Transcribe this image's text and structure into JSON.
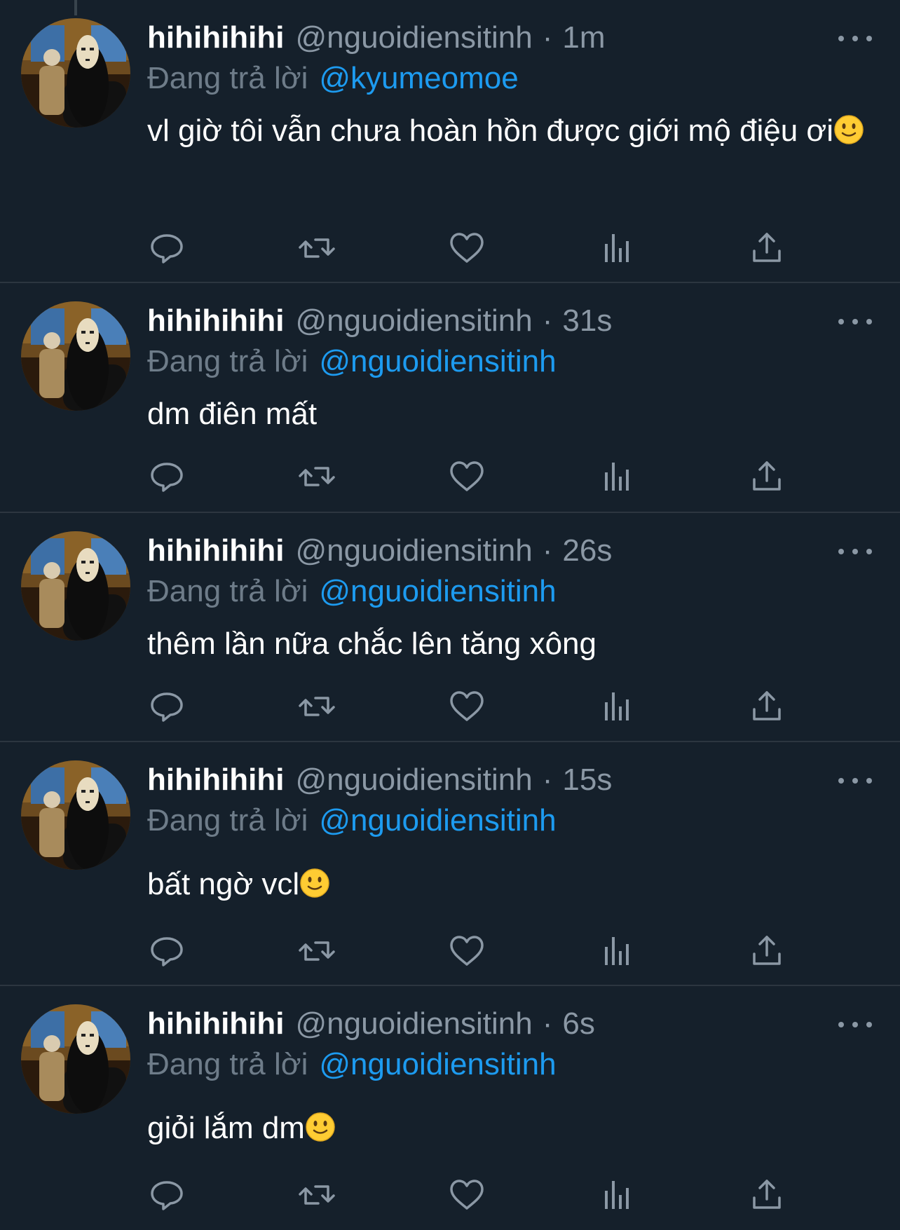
{
  "colors": {
    "background": "#15202b",
    "text": "#ffffff",
    "muted": "#8b98a5",
    "link": "#1d9bf0",
    "divider": "#2c3640"
  },
  "icons": [
    "reply-icon",
    "retweet-icon",
    "like-icon",
    "views-icon",
    "share-icon",
    "more-icon"
  ],
  "tweets": [
    {
      "display_name": "hihihihihi",
      "handle": "@nguoidiensitinh",
      "separator": "·",
      "time": "1m",
      "reply_prefix": "Đang trả lời",
      "reply_to": "@kyumeomoe",
      "text": "vl giờ tôi vẫn chưa hoàn hồn được giới mộ điệu ơi",
      "emoji": "slightly-smiling-face"
    },
    {
      "display_name": "hihihihihi",
      "handle": "@nguoidiensitinh",
      "separator": "·",
      "time": "31s",
      "reply_prefix": "Đang trả lời",
      "reply_to": "@nguoidiensitinh",
      "text": "dm điên mất",
      "emoji": ""
    },
    {
      "display_name": "hihihihihi",
      "handle": "@nguoidiensitinh",
      "separator": "·",
      "time": "26s",
      "reply_prefix": "Đang trả lời",
      "reply_to": "@nguoidiensitinh",
      "text": "thêm lần nữa chắc lên tăng xông",
      "emoji": ""
    },
    {
      "display_name": "hihihihihi",
      "handle": "@nguoidiensitinh",
      "separator": "·",
      "time": "15s",
      "reply_prefix": "Đang trả lời",
      "reply_to": "@nguoidiensitinh",
      "text": "bất ngờ vcl",
      "emoji": "slightly-smiling-face"
    },
    {
      "display_name": "hihihihihi",
      "handle": "@nguoidiensitinh",
      "separator": "·",
      "time": "6s",
      "reply_prefix": "Đang trả lời",
      "reply_to": "@nguoidiensitinh",
      "text": "giỏi lắm dm",
      "emoji": "slightly-smiling-face"
    }
  ]
}
